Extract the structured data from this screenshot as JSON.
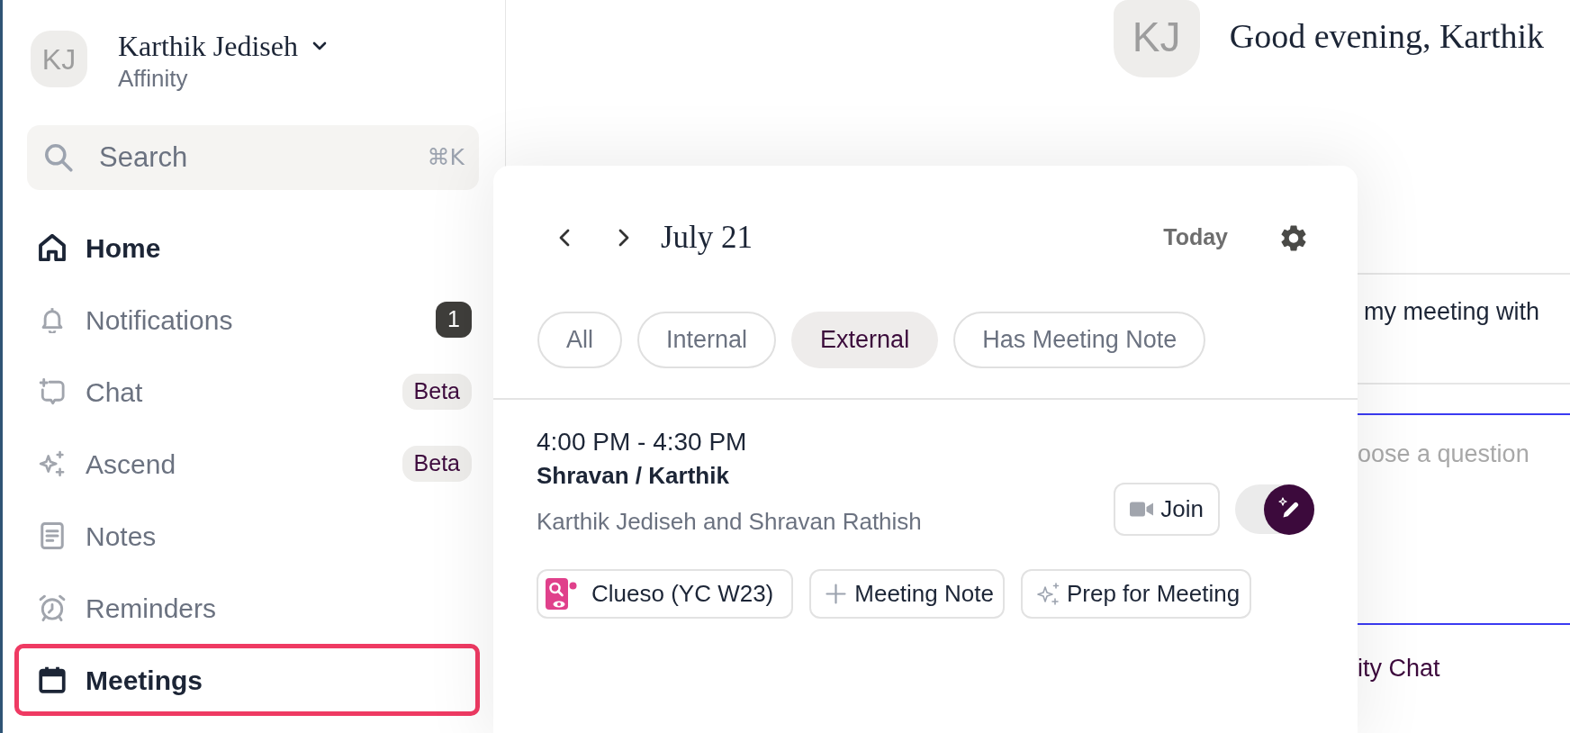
{
  "sidebar": {
    "profile": {
      "initials": "KJ",
      "name": "Karthik Jediseh",
      "workspace": "Affinity"
    },
    "search": {
      "placeholder": "Search",
      "shortcut": "⌘K"
    },
    "nav": [
      {
        "label": "Home",
        "selected": true,
        "highlighted": false
      },
      {
        "label": "Notifications",
        "selected": false,
        "highlighted": false,
        "badge": {
          "kind": "count",
          "text": "1"
        }
      },
      {
        "label": "Chat",
        "selected": false,
        "highlighted": false,
        "badge": {
          "kind": "tag",
          "text": "Beta"
        }
      },
      {
        "label": "Ascend",
        "selected": false,
        "highlighted": false,
        "badge": {
          "kind": "tag",
          "text": "Beta"
        }
      },
      {
        "label": "Notes",
        "selected": false,
        "highlighted": false
      },
      {
        "label": "Reminders",
        "selected": false,
        "highlighted": false
      },
      {
        "label": "Meetings",
        "selected": true,
        "highlighted": true
      }
    ]
  },
  "header": {
    "initials": "KJ",
    "greeting": "Good evening, Karthik"
  },
  "background_panel": {
    "suggestion": "my meeting with",
    "question_field": {
      "placeholder": "oose a question"
    },
    "link": "ity Chat"
  },
  "calendar_popup": {
    "date": "July 21",
    "today_label": "Today",
    "filters": [
      {
        "label": "All",
        "selected": false
      },
      {
        "label": "Internal",
        "selected": false
      },
      {
        "label": "External",
        "selected": true
      },
      {
        "label": "Has Meeting Note",
        "selected": false
      }
    ],
    "meetings": [
      {
        "time": "4:00 PM - 4:30 PM",
        "title": "Shravan / Karthik",
        "attendees": "Karthik Jediseh and Shravan Rathish",
        "join_label": "Join",
        "toggle": {
          "on": true
        },
        "chips": [
          {
            "kind": "company",
            "label": "Clueso (YC W23)"
          },
          {
            "kind": "add",
            "label": "Meeting Note"
          },
          {
            "kind": "ai",
            "label": "Prep for Meeting"
          }
        ]
      }
    ]
  }
}
